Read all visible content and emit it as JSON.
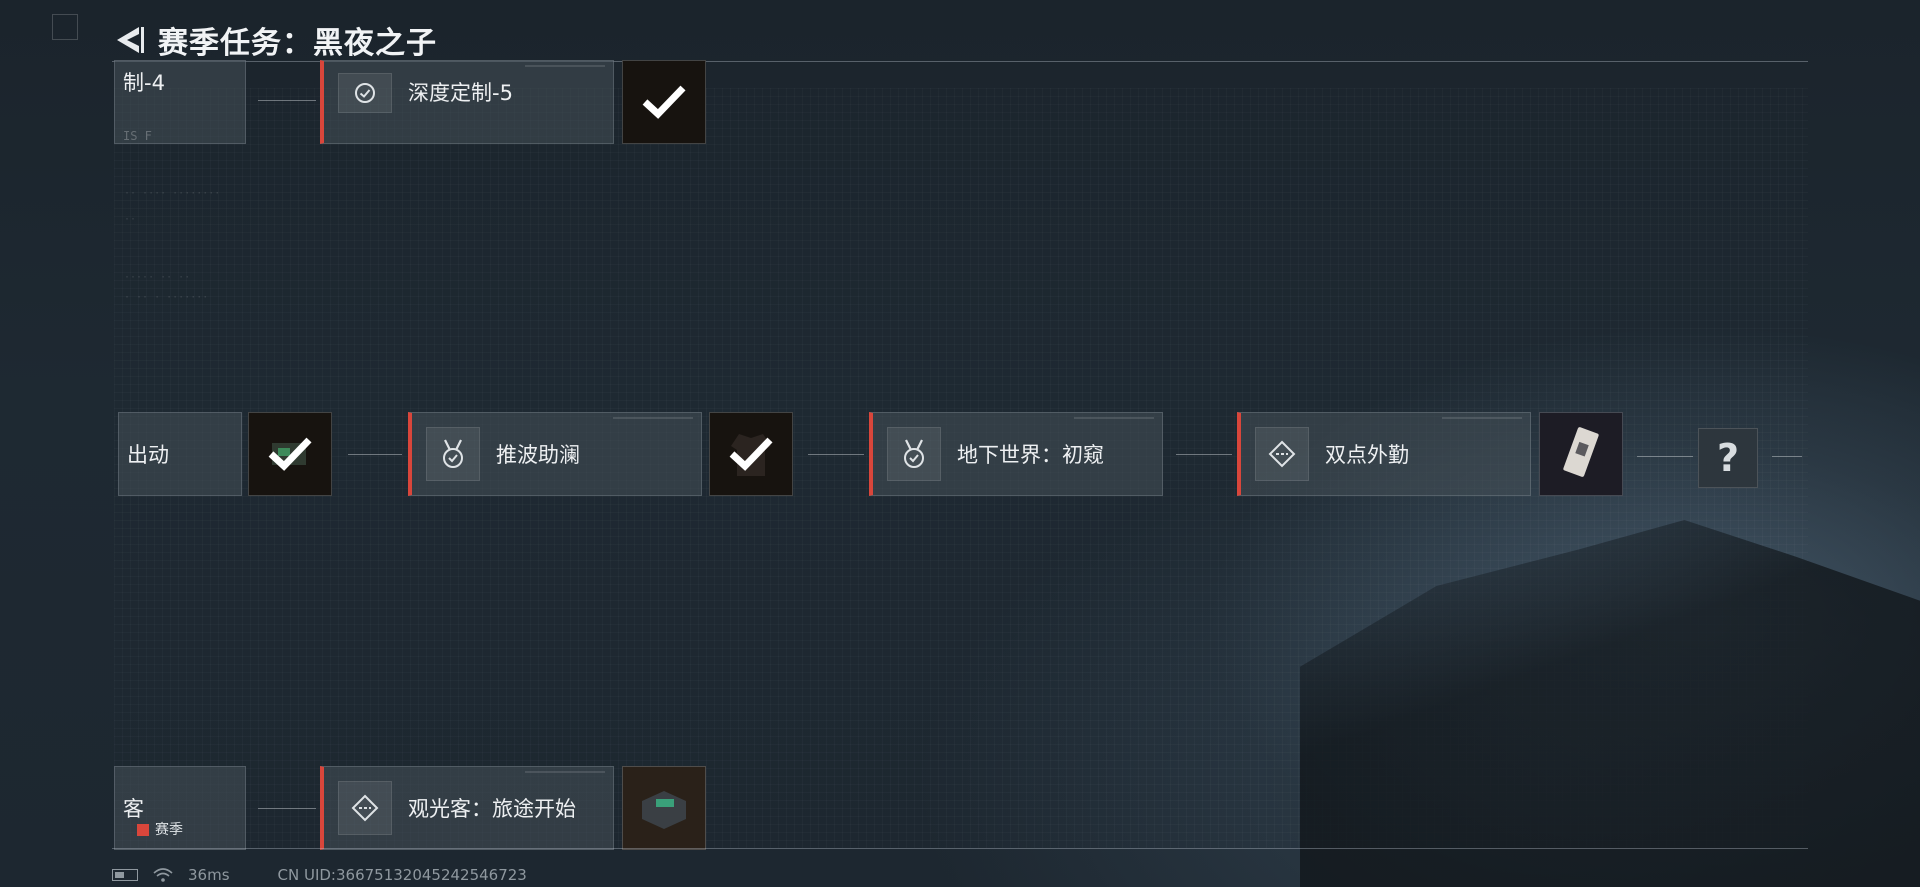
{
  "header": {
    "title": "赛季任务：黑夜之子"
  },
  "top_row": {
    "partial_label": "制-4",
    "partial_sub": "IS F",
    "card_label": "深度定制-5"
  },
  "middle_row": {
    "partial_label": "出动",
    "cards": [
      {
        "label": "推波助澜",
        "icon": "medal-icon"
      },
      {
        "label": "地下世界：初窥",
        "icon": "medal-icon"
      },
      {
        "label": "双点外勤",
        "icon": "route-diamond-icon"
      }
    ],
    "mystery": "?"
  },
  "bottom_row": {
    "partial_label": "客",
    "partial_tag": "赛季",
    "card_label": "观光客：旅途开始"
  },
  "status": {
    "ping": "36ms",
    "uid": "CN UID:366751320452425467​23"
  },
  "colors": {
    "accent_red": "#d9463b",
    "text": "#eef0f2"
  }
}
